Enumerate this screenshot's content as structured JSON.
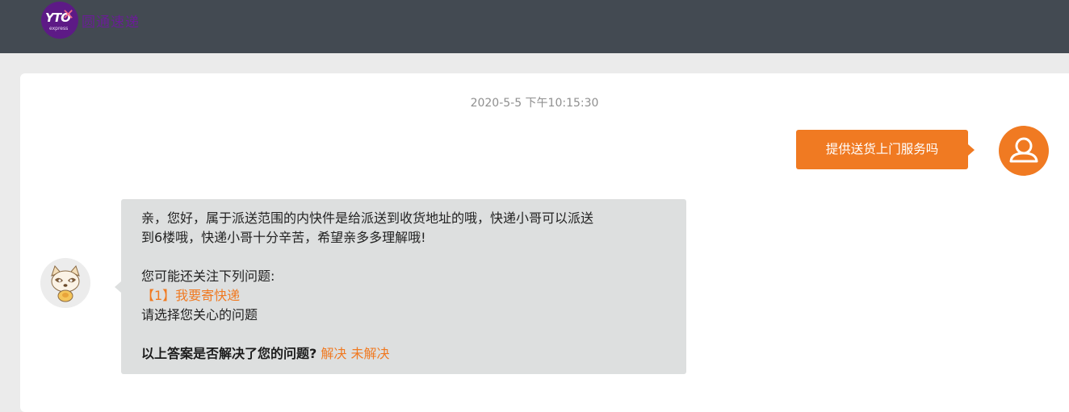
{
  "header": {
    "logo_badge_text": "YTO",
    "logo_badge_sub": "express",
    "logo_text": "圆通速递"
  },
  "chat": {
    "timestamp": "2020-5-5 下午10:15:30",
    "user_message": "提供送货上门服务吗",
    "bot": {
      "line1": "亲，您好，属于派送范围的内快件是给派送到收货地址的哦，快递小哥可以派送",
      "line2": "到6楼哦，快递小哥十分辛苦，希望亲多多理解哦!",
      "related_title": "您可能还关注下列问题:",
      "related_item": "【1】我要寄快递",
      "prompt": "请选择您关心的问题",
      "feedback_question": "以上答案是否解决了您的问题?",
      "feedback_yes": "解决",
      "feedback_no": "未解决"
    }
  },
  "colors": {
    "header_bg": "#434a52",
    "accent": "#f07a22",
    "bot_bubble": "#dddfdf",
    "brand_purple": "#5d1a86"
  }
}
